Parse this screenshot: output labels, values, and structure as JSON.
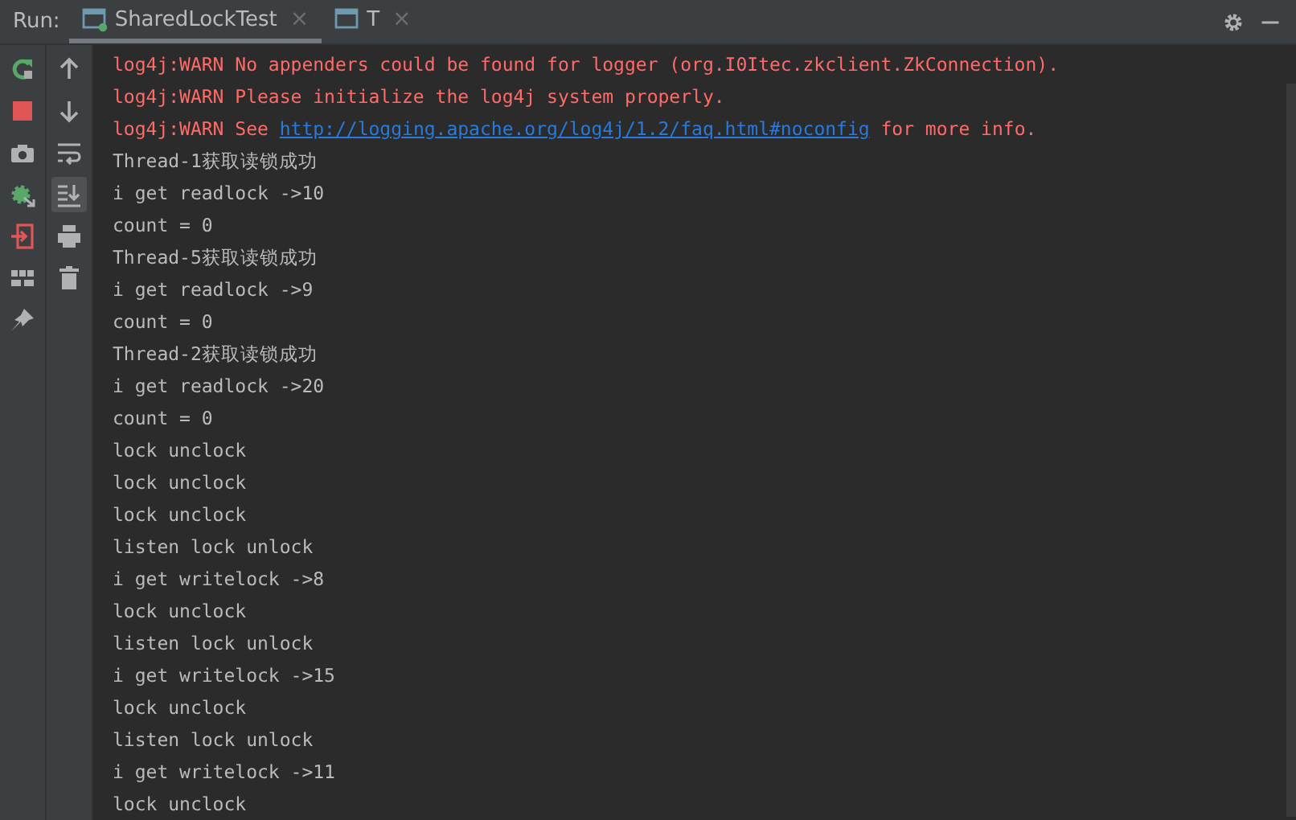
{
  "run_label": "Run:",
  "tabs": [
    {
      "label": "SharedLockTest",
      "selected": true,
      "running": true,
      "close": "×"
    },
    {
      "label": "T",
      "selected": false,
      "running": false,
      "close": "×"
    }
  ],
  "toolbar_left": [
    {
      "kind": "rerun"
    },
    {
      "kind": "stop"
    },
    {
      "kind": "camera"
    },
    {
      "kind": "debug"
    },
    {
      "kind": "exit"
    },
    {
      "kind": "layout"
    },
    {
      "kind": "pin"
    }
  ],
  "toolbar_right": [
    {
      "kind": "up",
      "selected": false
    },
    {
      "kind": "down",
      "selected": false
    },
    {
      "kind": "wrap",
      "selected": false
    },
    {
      "kind": "scroll-end",
      "selected": true
    },
    {
      "kind": "print",
      "selected": false
    },
    {
      "kind": "trash",
      "selected": false
    }
  ],
  "console": [
    {
      "kind": "warn",
      "text": "log4j:WARN No appenders could be found for logger (org.I0Itec.zkclient.ZkConnection)."
    },
    {
      "kind": "warn",
      "text": "log4j:WARN Please initialize the log4j system properly."
    },
    {
      "kind": "warn",
      "text": "log4j:WARN See ",
      "link": "http://logging.apache.org/log4j/1.2/faq.html#noconfig",
      "after": " for more info."
    },
    {
      "kind": "out",
      "text": "Thread-1获取读锁成功"
    },
    {
      "kind": "out",
      "text": "i get readlock ->10"
    },
    {
      "kind": "out",
      "text": "count = 0"
    },
    {
      "kind": "out",
      "text": "Thread-5获取读锁成功"
    },
    {
      "kind": "out",
      "text": "i get readlock ->9"
    },
    {
      "kind": "out",
      "text": "count = 0"
    },
    {
      "kind": "out",
      "text": "Thread-2获取读锁成功"
    },
    {
      "kind": "out",
      "text": "i get readlock ->20"
    },
    {
      "kind": "out",
      "text": "count = 0"
    },
    {
      "kind": "out",
      "text": "lock unclock"
    },
    {
      "kind": "out",
      "text": "lock unclock"
    },
    {
      "kind": "out",
      "text": "lock unclock"
    },
    {
      "kind": "out",
      "text": "listen lock unlock"
    },
    {
      "kind": "out",
      "text": "i get writelock ->8"
    },
    {
      "kind": "out",
      "text": "lock unclock"
    },
    {
      "kind": "out",
      "text": "listen lock unlock"
    },
    {
      "kind": "out",
      "text": "i get writelock ->15"
    },
    {
      "kind": "out",
      "text": "lock unclock"
    },
    {
      "kind": "out",
      "text": "listen lock unlock"
    },
    {
      "kind": "out",
      "text": "i get writelock ->11"
    },
    {
      "kind": "out",
      "text": "lock unclock"
    }
  ]
}
